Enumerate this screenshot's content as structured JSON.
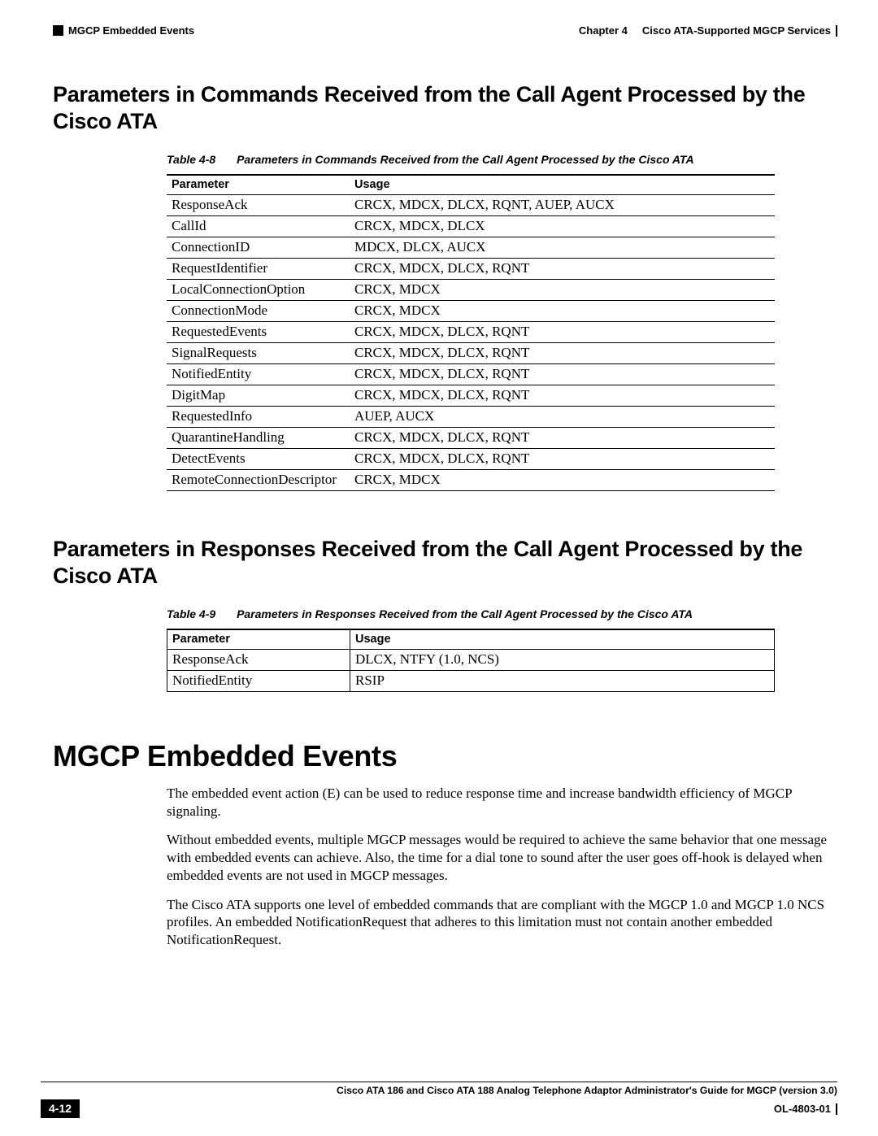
{
  "header": {
    "section_label": "MGCP Embedded Events",
    "chapter_label": "Chapter 4",
    "chapter_title": "Cisco ATA-Supported MGCP Services"
  },
  "section1": {
    "title": "Parameters in Commands Received from the Call Agent Processed by the Cisco ATA",
    "caption_label": "Table 4-8",
    "caption_text": "Parameters in Commands Received from the Call Agent Processed by the Cisco ATA",
    "col0": "Parameter",
    "col1": "Usage",
    "rows": [
      {
        "p": "ResponseAck",
        "u": "CRCX, MDCX, DLCX, RQNT, AUEP, AUCX"
      },
      {
        "p": "CallId",
        "u": "CRCX, MDCX, DLCX"
      },
      {
        "p": "ConnectionID",
        "u": "MDCX, DLCX, AUCX"
      },
      {
        "p": "RequestIdentifier",
        "u": "CRCX, MDCX, DLCX, RQNT"
      },
      {
        "p": "LocalConnectionOption",
        "u": "CRCX, MDCX"
      },
      {
        "p": "ConnectionMode",
        "u": "CRCX, MDCX"
      },
      {
        "p": "RequestedEvents",
        "u": "CRCX, MDCX, DLCX, RQNT"
      },
      {
        "p": "SignalRequests",
        "u": "CRCX, MDCX, DLCX, RQNT"
      },
      {
        "p": "NotifiedEntity",
        "u": "CRCX, MDCX, DLCX, RQNT"
      },
      {
        "p": "DigitMap",
        "u": "CRCX, MDCX, DLCX, RQNT"
      },
      {
        "p": "RequestedInfo",
        "u": "AUEP, AUCX"
      },
      {
        "p": "QuarantineHandling",
        "u": "CRCX, MDCX, DLCX, RQNT"
      },
      {
        "p": "DetectEvents",
        "u": "CRCX, MDCX, DLCX, RQNT"
      },
      {
        "p": "RemoteConnectionDescriptor",
        "u": "CRCX, MDCX"
      }
    ]
  },
  "section2": {
    "title": "Parameters in Responses Received from the Call Agent Processed by the Cisco ATA",
    "caption_label": "Table 4-9",
    "caption_text": "Parameters in Responses Received from the Call Agent Processed by the Cisco ATA",
    "col0": "Parameter",
    "col1": "Usage",
    "rows": [
      {
        "p": "ResponseAck",
        "u": "DLCX, NTFY (1.0, NCS)"
      },
      {
        "p": "NotifiedEntity",
        "u": "RSIP"
      }
    ]
  },
  "section3": {
    "title": "MGCP Embedded Events",
    "para1": "The embedded event action (E) can be used to reduce response time and increase bandwidth efficiency of MGCP signaling.",
    "para2": "Without embedded events, multiple MGCP messages would be required to achieve the same behavior that one message with embedded events can achieve. Also, the time for a dial tone to sound after the user goes off-hook is delayed when embedded events are not used in MGCP messages.",
    "para3": "The Cisco ATA supports one level of embedded commands that are compliant with the MGCP 1.0 and MGCP 1.0 NCS profiles. An embedded NotificationRequest that adheres to this limitation must not contain another embedded NotificationRequest."
  },
  "footer": {
    "guide": "Cisco ATA 186 and Cisco ATA 188 Analog Telephone Adaptor Administrator's Guide for MGCP (version 3.0)",
    "page": "4-12",
    "docid": "OL-4803-01"
  }
}
